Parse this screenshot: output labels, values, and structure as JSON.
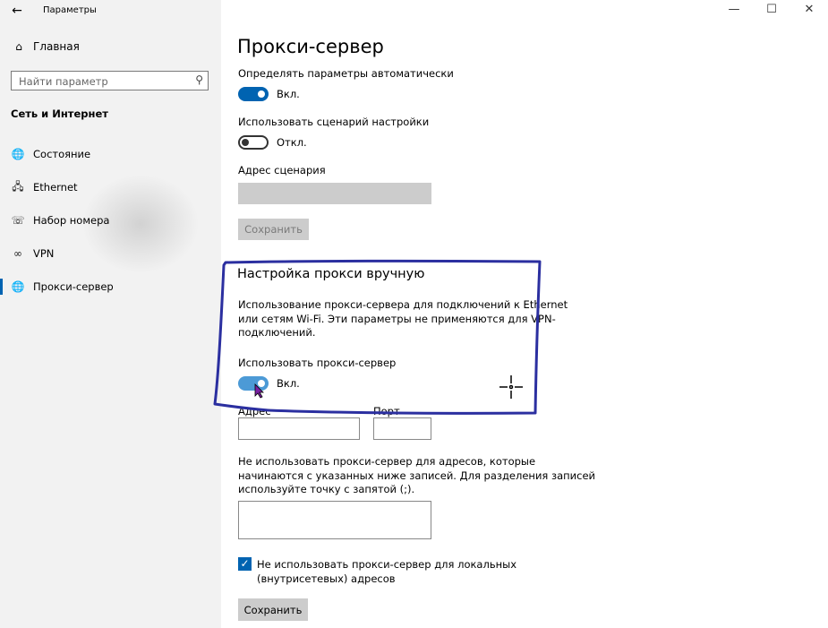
{
  "window": {
    "title": "Параметры",
    "back_icon": "arrow-left-icon",
    "controls": {
      "minimize": "—",
      "maximize": "☐",
      "close": "✕"
    }
  },
  "sidebar": {
    "home_label": "Главная",
    "search_placeholder": "Найти параметр",
    "section_title": "Сеть и Интернет",
    "items": [
      {
        "label": "Состояние",
        "icon": "globe-status-icon"
      },
      {
        "label": "Ethernet",
        "icon": "ethernet-icon"
      },
      {
        "label": "Набор номера",
        "icon": "dialup-icon"
      },
      {
        "label": "VPN",
        "icon": "vpn-icon"
      },
      {
        "label": "Прокси-сервер",
        "icon": "globe-icon",
        "active": true
      }
    ]
  },
  "main": {
    "title": "Прокси-сервер",
    "auto": {
      "detect_label": "Определять параметры автоматически",
      "detect_state": "Вкл.",
      "script_label": "Использовать сценарий настройки",
      "script_state": "Откл.",
      "address_label": "Адрес сценария",
      "save_label": "Сохранить"
    },
    "manual": {
      "title": "Настройка прокси вручную",
      "description_lines": [
        "Использование прокси-сервера для подключений к Ethernet",
        "или сетям Wi-Fi. Эти параметры не применяются для VPN-",
        "подключений."
      ],
      "use_proxy_label": "Использовать прокси-сервер",
      "use_proxy_state": "Вкл.",
      "address_label": "Адрес",
      "port_label": "Порт",
      "exceptions_lines": [
        "Не использовать прокси-сервер для адресов, которые",
        "начинаются с указанных ниже записей. Для разделения записей",
        "используйте точку с запятой (;)."
      ],
      "local_checkbox_lines": [
        "Не использовать прокси-сервер для локальных",
        "(внутрисетевых) адресов"
      ],
      "local_checked": true,
      "save_label": "Сохранить"
    }
  },
  "colors": {
    "accent": "#0063b1",
    "annotation": "#2b2fa0",
    "sidebar_bg": "#f2f2f2"
  }
}
